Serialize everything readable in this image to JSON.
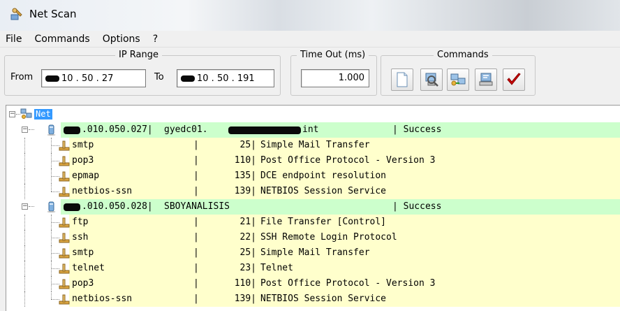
{
  "window": {
    "title": "Net Scan",
    "icon": "wrench-net-icon"
  },
  "menu": {
    "items": [
      "File",
      "Commands",
      "Options",
      "?"
    ]
  },
  "ip_range": {
    "legend": "IP Range",
    "from_label": "From",
    "from_value": "10 . 50 . 27",
    "to_label": "To",
    "to_value": "10 . 50 . 191"
  },
  "timeout": {
    "legend": "Time Out (ms)",
    "value": "1.000"
  },
  "commands": {
    "legend": "Commands",
    "buttons": [
      "new-document-icon",
      "search-computer-icon",
      "network-icon",
      "computer-scan-icon",
      "checkmark-icon"
    ]
  },
  "tree": {
    "root_label": "Net",
    "rows": [
      {
        "type": "host",
        "ip": ".010.050.027|",
        "name": "gyedc01.",
        "name_tail": "int",
        "status": "| Success"
      },
      {
        "type": "svc",
        "service": "smtp",
        "port": "25|",
        "desc": "Simple Mail Transfer"
      },
      {
        "type": "svc",
        "service": "pop3",
        "port": "110|",
        "desc": "Post Office Protocol - Version 3"
      },
      {
        "type": "svc",
        "service": "epmap",
        "port": "135|",
        "desc": "DCE endpoint resolution"
      },
      {
        "type": "svc",
        "service": "netbios-ssn",
        "port": "139|",
        "desc": "NETBIOS Session Service"
      },
      {
        "type": "host",
        "ip": ".010.050.028|",
        "name": "SBOYANALISIS",
        "name_tail": "",
        "status": "| Success"
      },
      {
        "type": "svc",
        "service": "ftp",
        "port": "21|",
        "desc": "File Transfer [Control]"
      },
      {
        "type": "svc",
        "service": "ssh",
        "port": "22|",
        "desc": "SSH Remote Login Protocol"
      },
      {
        "type": "svc",
        "service": "smtp",
        "port": "25|",
        "desc": "Simple Mail Transfer"
      },
      {
        "type": "svc",
        "service": "telnet",
        "port": "23|",
        "desc": "Telnet"
      },
      {
        "type": "svc",
        "service": "pop3",
        "port": "110|",
        "desc": "Post Office Protocol - Version 3"
      },
      {
        "type": "svc",
        "service": "netbios-ssn",
        "port": "139|",
        "desc": "NETBIOS Session Service"
      }
    ],
    "separator": "|"
  },
  "colors": {
    "host_row": "#ccffcc",
    "service_row": "#ffffcc",
    "selection": "#3399ff",
    "check": "#cc0000"
  }
}
